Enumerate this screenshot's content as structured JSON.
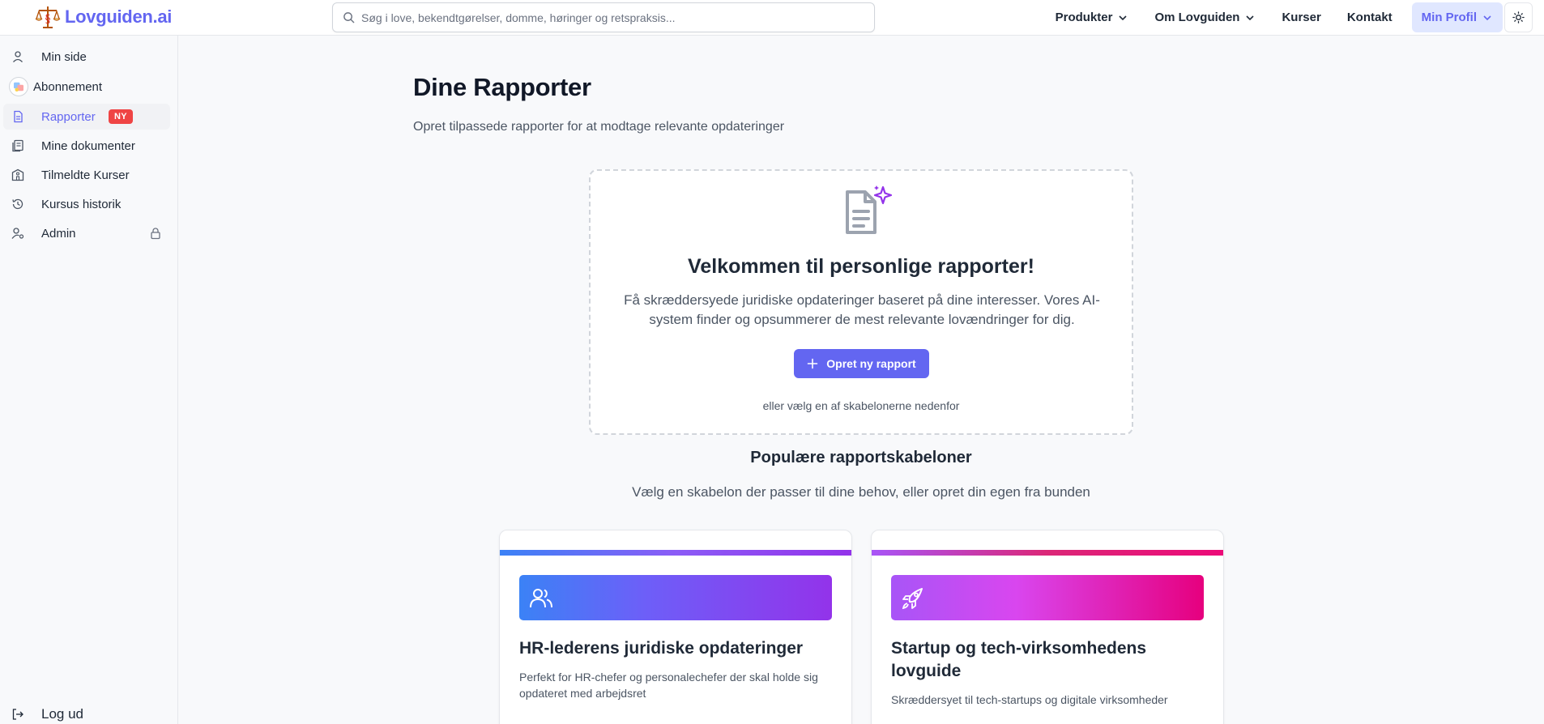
{
  "app": {
    "logo_text": "Lovguiden.ai"
  },
  "search": {
    "placeholder": "Søg i love, bekendtgørelser, domme, høringer og retspraksis..."
  },
  "nav": {
    "produkter": "Produkter",
    "om": "Om Lovguiden",
    "kurser": "Kurser",
    "kontakt": "Kontakt",
    "profil": "Min Profil"
  },
  "sidebar": {
    "items": [
      {
        "label": "Min side",
        "icon": "user-icon"
      },
      {
        "label": "Abonnement",
        "icon": "subscription-avatar-icon"
      },
      {
        "label": "Rapporter",
        "icon": "file-text-icon",
        "badge": "NY",
        "active": true
      },
      {
        "label": "Mine dokumenter",
        "icon": "documents-icon"
      },
      {
        "label": "Tilmeldte Kurser",
        "icon": "school-icon"
      },
      {
        "label": "Kursus historik",
        "icon": "history-icon"
      },
      {
        "label": "Admin",
        "icon": "user-cog-icon",
        "locked": true
      }
    ],
    "logout": "Log ud"
  },
  "main": {
    "title": "Dine Rapporter",
    "subtitle": "Opret tilpassede rapporter for at modtage relevante opdateringer",
    "welcome": {
      "title": "Velkommen til personlige rapporter!",
      "description": "Få skræddersyede juridiske opdateringer baseret på dine interesser. Vores AI-system finder og opsummerer de mest relevante lovændringer for dig.",
      "button": "Opret ny rapport",
      "alt_text": "eller vælg en af skabelonerne nedenfor"
    },
    "templates": {
      "title": "Populære rapportskabeloner",
      "subtitle": "Vælg en skabelon der passer til dine behov, eller opret din egen fra bunden",
      "cards": [
        {
          "title": "HR-lederens juridiske opdateringer",
          "description": "Perfekt for HR-chefer og personalechefer der skal holde sig opdateret med arbejdsret",
          "icon": "users-icon"
        },
        {
          "title": "Startup og tech-virksomhedens lovguide",
          "description": "Skræddersyet til tech-startups og digitale virksomheder",
          "icon": "rocket-icon"
        }
      ]
    }
  },
  "colors": {
    "accent": "#6366f1",
    "badge": "#ef4444"
  }
}
